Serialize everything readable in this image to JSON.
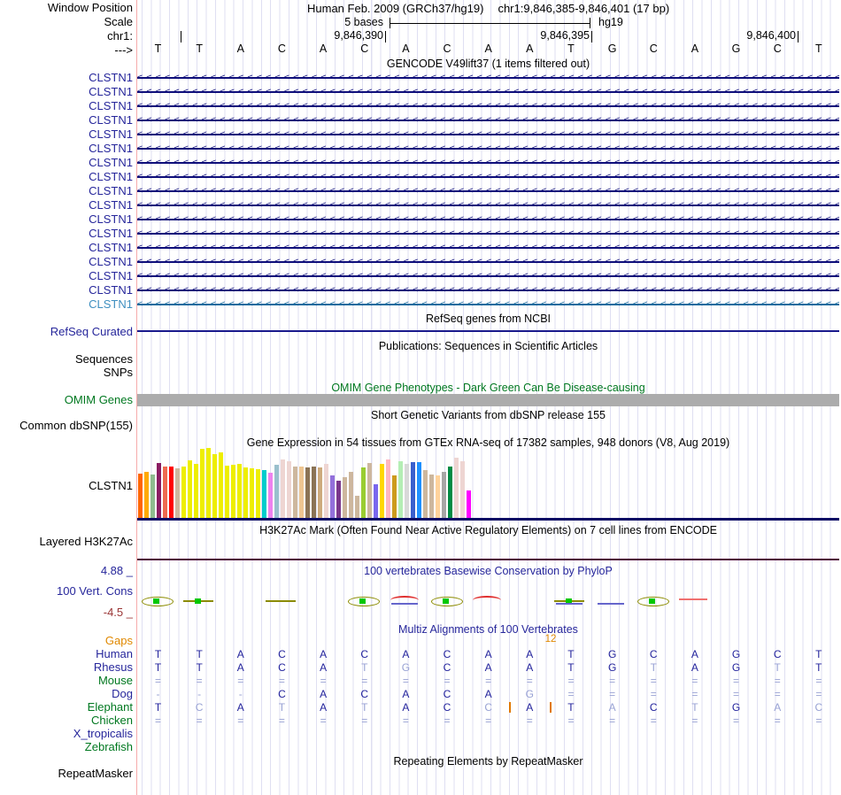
{
  "header": {
    "window_position_label": "Window Position",
    "genome": "Human Feb. 2009 (GRCh37/hg19)",
    "position": "chr1:9,846,385-9,846,401 (17 bp)",
    "scale_label": "Scale",
    "scale_bases": "5 bases",
    "assembly": "hg19",
    "chrom_label": "chr1:",
    "coords": [
      "9,846,390",
      "9,846,395",
      "9,846,400"
    ],
    "strand_label": "--->",
    "sequence": [
      "T",
      "T",
      "A",
      "C",
      "A",
      "C",
      "A",
      "C",
      "A",
      "A",
      "T",
      "G",
      "C",
      "A",
      "G",
      "C",
      "T"
    ]
  },
  "gencode": {
    "title": "GENCODE V49lift37 (1 items filtered out)",
    "rows": [
      {
        "label": "CLSTN1",
        "style": "navy"
      },
      {
        "label": "CLSTN1",
        "style": "navy"
      },
      {
        "label": "CLSTN1",
        "style": "navy"
      },
      {
        "label": "CLSTN1",
        "style": "navy"
      },
      {
        "label": "CLSTN1",
        "style": "navy"
      },
      {
        "label": "CLSTN1",
        "style": "navy"
      },
      {
        "label": "CLSTN1",
        "style": "navy"
      },
      {
        "label": "CLSTN1",
        "style": "navy"
      },
      {
        "label": "CLSTN1",
        "style": "navy"
      },
      {
        "label": "CLSTN1",
        "style": "navy"
      },
      {
        "label": "CLSTN1",
        "style": "navy"
      },
      {
        "label": "CLSTN1",
        "style": "navy"
      },
      {
        "label": "CLSTN1",
        "style": "navy"
      },
      {
        "label": "CLSTN1",
        "style": "navy"
      },
      {
        "label": "CLSTN1",
        "style": "navy"
      },
      {
        "label": "CLSTN1",
        "style": "navy"
      },
      {
        "label": "CLSTN1",
        "style": "lightblue"
      }
    ]
  },
  "refseq": {
    "title": "RefSeq genes from NCBI",
    "label": "RefSeq Curated"
  },
  "publications": {
    "title": "Publications: Sequences in Scientific Articles",
    "labels": [
      "Sequences",
      "SNPs"
    ]
  },
  "omim": {
    "title": "OMIM Gene Phenotypes - Dark Green Can Be Disease-causing",
    "label": "OMIM Genes",
    "bar_color": "#ACACAC"
  },
  "dbsnp": {
    "title": "Short Genetic Variants from dbSNP release 155",
    "label": "Common dbSNP(155)"
  },
  "gtex": {
    "title": "Gene Expression in 54 tissues from GTEx RNA-seq of 17382 samples, 948 donors (V8, Aug 2019)",
    "label": "CLSTN1",
    "heights": [
      50,
      52,
      49,
      62,
      58,
      58,
      56,
      58,
      65,
      61,
      78,
      79,
      72,
      74,
      59,
      60,
      61,
      57,
      56,
      55,
      54,
      51,
      60,
      66,
      64,
      58,
      58,
      57,
      58,
      57,
      61,
      48,
      42,
      46,
      52,
      25,
      57,
      62,
      38,
      61,
      66,
      48,
      64,
      61,
      63,
      63,
      54,
      49,
      48,
      52,
      58,
      68,
      64,
      31
    ],
    "colors": [
      "#FF6600",
      "#FFAA00",
      "#8FBC8F",
      "#8B1C62",
      "#EE6A50",
      "#FF0000",
      "#CDB79E",
      "#EEEE00",
      "#EEEE00",
      "#EEEE00",
      "#EEEE00",
      "#EEEE00",
      "#EEEE00",
      "#EEEE00",
      "#EEEE00",
      "#EEEE00",
      "#EEEE00",
      "#EEEE00",
      "#EEEE00",
      "#EEEE00",
      "#00CDCD",
      "#EE82EE",
      "#9AC0CD",
      "#EED5D2",
      "#EED5D2",
      "#CDB79E",
      "#EEC591",
      "#8B7355",
      "#8B7355",
      "#CDAA7D",
      "#EED5D2",
      "#9370DB",
      "#7A378B",
      "#CDB79E",
      "#CDB79E",
      "#CDB79E",
      "#9ACD32",
      "#CDB79E",
      "#7A67EE",
      "#FFD700",
      "#FFB6C1",
      "#CD9B1D",
      "#B4EEB4",
      "#D9D9D9",
      "#3A5FCD",
      "#1E90FF",
      "#CDB79E",
      "#CDB79E",
      "#FFD39B",
      "#A6A6A6",
      "#008B45",
      "#EED5D2",
      "#EED5D2",
      "#FF00FF"
    ]
  },
  "h3k27ac": {
    "title": "H3K27Ac Mark (Often Found Near Active Regulatory Elements) on 7 cell lines from ENCODE",
    "label": "Layered H3K27Ac",
    "line_color": "#4D0038"
  },
  "phylop": {
    "title": "100 vertebrates Basewise Conservation by PhyloP",
    "label": "100 Vert. Cons",
    "max": "4.88 _",
    "min": "-4.5 _",
    "glyphs": [
      {
        "base": 1,
        "parts": [
          "lens",
          "greenbox"
        ]
      },
      {
        "base": 2,
        "parts": [
          "oliveline",
          "greenbox"
        ]
      },
      {
        "base": 4,
        "parts": [
          "oliveline"
        ]
      },
      {
        "base": 6,
        "parts": [
          "lens",
          "greenbox"
        ]
      },
      {
        "base": 7,
        "parts": [
          "redarc",
          "blueline"
        ]
      },
      {
        "base": 8,
        "parts": [
          "lens",
          "greenbox"
        ]
      },
      {
        "base": 9,
        "parts": [
          "redarc"
        ]
      },
      {
        "base": 11,
        "parts": [
          "oliveline",
          "greenbox",
          "blueline"
        ]
      },
      {
        "base": 12,
        "parts": [
          "blueline"
        ]
      },
      {
        "base": 13,
        "parts": [
          "lens",
          "greenbox"
        ]
      },
      {
        "base": 14,
        "parts": [
          "pinkline"
        ]
      }
    ]
  },
  "multiz": {
    "title": "Multiz Alignments of 100 Vertebrates",
    "gap_count": "12",
    "insert_base": 10,
    "species": [
      {
        "name": "Gaps",
        "color": "orange",
        "cells": []
      },
      {
        "name": "Human",
        "color": "navy",
        "cells": [
          "T",
          "T",
          "A",
          "C",
          "A",
          "C",
          "A",
          "C",
          "A",
          "A",
          "T",
          "G",
          "C",
          "A",
          "G",
          "C",
          "T"
        ]
      },
      {
        "name": "Rhesus",
        "color": "navy",
        "cells": [
          "T",
          "T",
          "A",
          "C",
          "A",
          "t",
          "g",
          "C",
          "A",
          "A",
          "T",
          "G",
          "t",
          "A",
          "G",
          "t",
          "T"
        ]
      },
      {
        "name": "Mouse",
        "color": "green",
        "cells": [
          "=",
          "=",
          "=",
          "=",
          "=",
          "=",
          "=",
          "=",
          "=",
          "=",
          "=",
          "=",
          "=",
          "=",
          "=",
          "=",
          "="
        ]
      },
      {
        "name": "Dog",
        "color": "navy",
        "cells": [
          "-",
          "-",
          "-",
          "C",
          "A",
          "C",
          "A",
          "C",
          "A",
          "g",
          "=",
          "=",
          "=",
          "=",
          "=",
          "=",
          "="
        ]
      },
      {
        "name": "Elephant",
        "color": "green",
        "cells": [
          "T",
          "c",
          "A",
          "t",
          "A",
          "t",
          "A",
          "C",
          "c",
          "A",
          "T",
          "a",
          "C",
          "t",
          "G",
          "a",
          "c"
        ]
      },
      {
        "name": "Chicken",
        "color": "green",
        "cells": [
          "=",
          "=",
          "=",
          "=",
          "=",
          "=",
          "=",
          "=",
          "=",
          "=",
          "=",
          "=",
          "=",
          "=",
          "=",
          "=",
          "="
        ]
      },
      {
        "name": "X_tropicalis",
        "color": "navy",
        "cells": [
          "",
          "",
          "",
          "",
          "",
          "",
          "",
          "",
          "",
          "",
          "",
          "",
          "",
          "",
          "",
          "",
          ""
        ]
      },
      {
        "name": "Zebrafish",
        "color": "green",
        "cells": [
          "",
          "",
          "",
          "",
          "",
          "",
          "",
          "",
          "",
          "",
          "",
          "",
          "",
          "",
          "",
          "",
          ""
        ]
      }
    ]
  },
  "repeatmasker": {
    "title": "Repeating Elements by RepeatMasker",
    "label": "RepeatMasker"
  }
}
